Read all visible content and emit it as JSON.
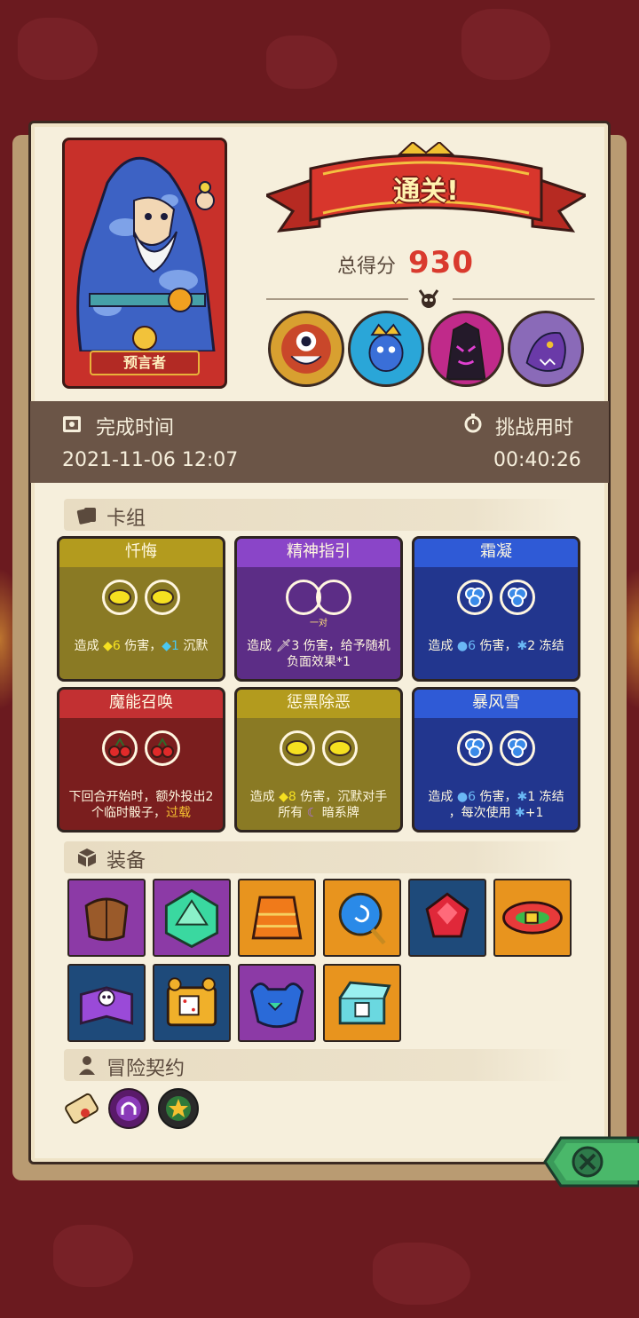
{
  "hero": {
    "name": "预言者"
  },
  "result": {
    "banner": "通关!",
    "score_label": "总得分",
    "score_value": "930"
  },
  "bosses": [
    {
      "name": "boss-eye"
    },
    {
      "name": "boss-crown"
    },
    {
      "name": "boss-shadow"
    },
    {
      "name": "boss-dragon"
    }
  ],
  "time": {
    "finish_label": "完成时间",
    "finish_value": "2021-11-06 12:07",
    "challenge_label": "挑战用时",
    "challenge_value": "00:40:26"
  },
  "deck": {
    "header": "卡组",
    "cards": [
      {
        "title": "忏悔",
        "color": "yellow",
        "dice": "lemon",
        "desc_a": "造成 ",
        "num": "6",
        "desc_b": " 伤害，",
        "num2": "1",
        "desc_c": " 沉默"
      },
      {
        "title": "精神指引",
        "color": "purple",
        "dice": "empty",
        "sub": "一对",
        "desc_a": "造成 ",
        "num": "3",
        "desc_b": " 伤害，给予随机",
        "desc_c": "负面效果*1"
      },
      {
        "title": "霜凝",
        "color": "blue",
        "dice": "frost",
        "desc_a": "造成 ",
        "num": "6",
        "desc_b": " 伤害，",
        "num2": "2",
        "desc_c": " 冻结"
      },
      {
        "title": "魔能召唤",
        "color": "red",
        "dice": "cherry",
        "desc_a": "下回合开始时，额外投出2",
        "desc_b": "个临时骰子，",
        "desc_link": "过载"
      },
      {
        "title": "惩黑除恶",
        "color": "yellow",
        "dice": "lemon",
        "desc_a": "造成 ",
        "num": "8",
        "desc_b": " 伤害，沉默对手",
        "desc_c": "所有 ",
        "desc_d": " 暗系牌"
      },
      {
        "title": "暴风雪",
        "color": "blue",
        "dice": "frost",
        "desc_a": "造成 ",
        "num": "6",
        "desc_b": " 伤害，",
        "num2": "1",
        "desc_c": " 冻结",
        "desc_d": "，每次使用 ",
        "desc_e": "+1"
      }
    ]
  },
  "equipment": {
    "header": "装备",
    "items": [
      {
        "name": "leather-bracer",
        "bg": "purple"
      },
      {
        "name": "green-d20",
        "bg": "purple"
      },
      {
        "name": "orange-robe",
        "bg": "orange"
      },
      {
        "name": "blue-swirl-charm",
        "bg": "orange"
      },
      {
        "name": "red-gem",
        "bg": "blue"
      },
      {
        "name": "colorful-belt",
        "bg": "orange"
      },
      {
        "name": "skull-spellbook",
        "bg": "blue"
      },
      {
        "name": "dice-chest",
        "bg": "blue"
      },
      {
        "name": "demon-mask",
        "bg": "purple"
      },
      {
        "name": "treasure-box",
        "bg": "orange"
      }
    ]
  },
  "contracts": {
    "header": "冒险契约",
    "items": [
      "scroll-contract",
      "purple-omega-token",
      "green-star-token"
    ]
  }
}
